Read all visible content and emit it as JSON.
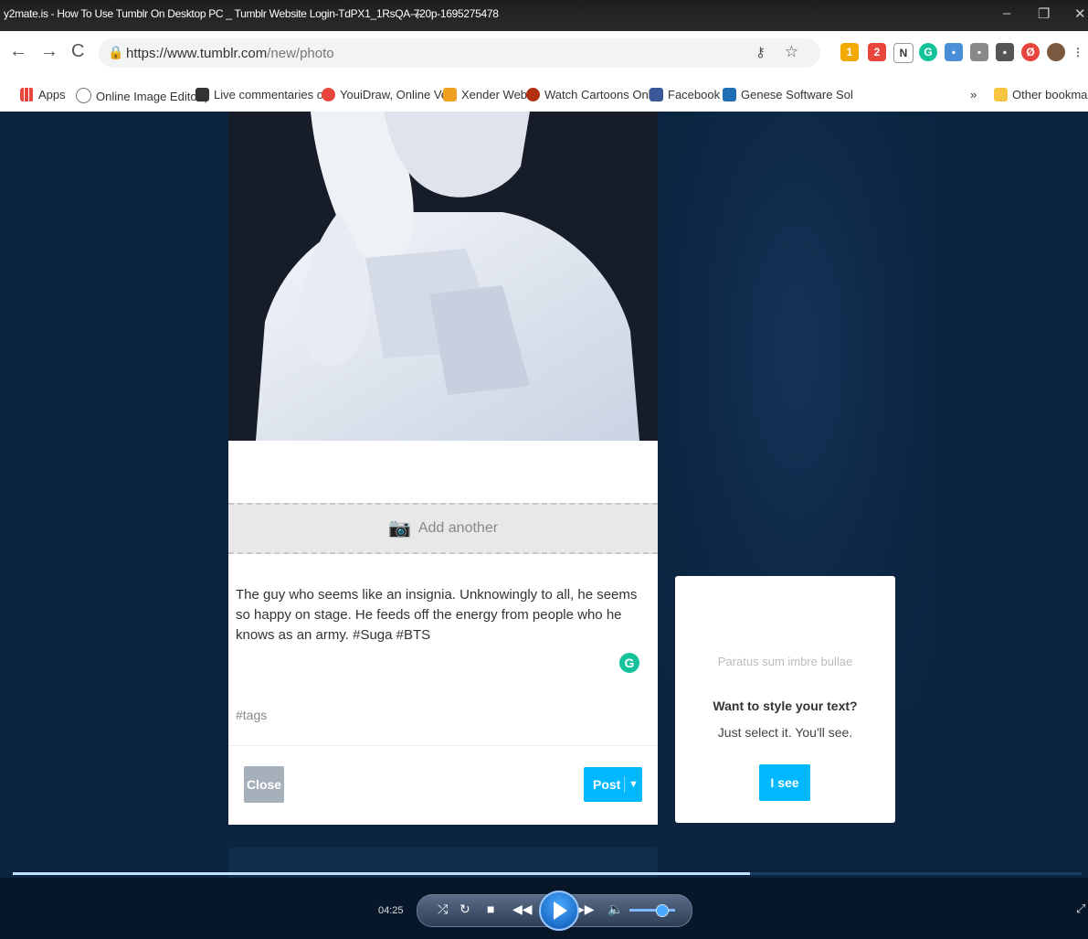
{
  "window": {
    "title": "y2mate.is - How To Use Tumblr On Desktop PC _ Tumblr Website Login-TdPX1_1RsQA-720p-1695275478"
  },
  "browser": {
    "url_host": "https://www.tumblr.com",
    "url_path": "/new/photo",
    "bookmarks": [
      {
        "label": "Apps",
        "color": "#e8453c"
      },
      {
        "label": "Online Image Editor |",
        "color": "#777777"
      },
      {
        "label": "Live commentaries o",
        "color": "#333333"
      },
      {
        "label": "YouiDraw, Online Vec",
        "color": "#e8453c"
      },
      {
        "label": "Xender Web",
        "color": "#f0a020"
      },
      {
        "label": "Watch Cartoons Onli",
        "color": "#b03010"
      },
      {
        "label": "Facebook",
        "color": "#3b5998"
      },
      {
        "label": "Genese Software Sol",
        "color": "#1e6fb5"
      }
    ],
    "more_bookmarks": "»",
    "other_bookmarks": "Other bookmarks"
  },
  "composer": {
    "add_another_label": "Add another",
    "caption": "The guy who seems like an insignia. Unknowingly to all, he seems so happy on stage. He feeds off the energy from people who he knows as an army. #Suga #BTS",
    "tags_placeholder": "#tags",
    "close_label": "Close",
    "post_label": "Post"
  },
  "tip_card": {
    "placeholder": "Paratus sum imbre bullae",
    "heading": "Want to style your text?",
    "subtext": "Just select it. You'll see.",
    "button_label": "I see"
  },
  "player": {
    "elapsed": "04:25",
    "progress": 0.69,
    "volume": 0.8
  },
  "colors": {
    "accent": "#00b8ff",
    "close_button": "#a6b0bb",
    "page_bg": "#0c2440",
    "grammarly": "#15c39a"
  }
}
